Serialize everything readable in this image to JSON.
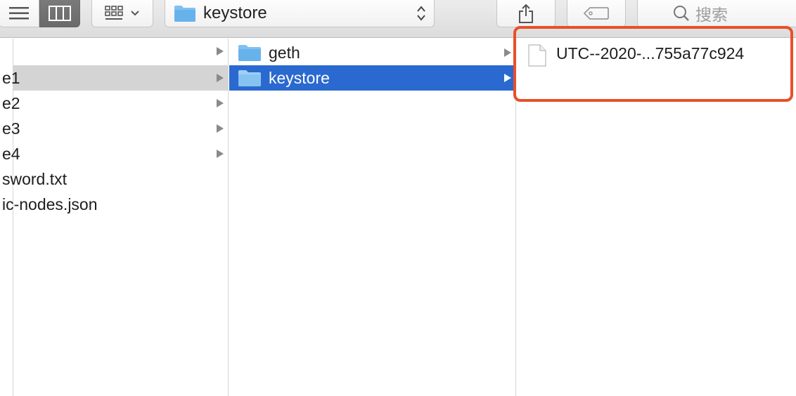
{
  "toolbar": {
    "view_list_icon": "list-view-icon",
    "view_column_icon": "column-view-icon",
    "group_icon": "grid-group-icon",
    "path_label": "keystore",
    "share_icon": "share-icon",
    "tag_icon": "tag-icon",
    "search_placeholder": "搜索"
  },
  "columns": {
    "col1": [
      {
        "label": "e1",
        "has_children": true,
        "selected": true
      },
      {
        "label": "e2",
        "has_children": true
      },
      {
        "label": "e3",
        "has_children": true
      },
      {
        "label": "e4",
        "has_children": true
      },
      {
        "label": "sword.txt",
        "has_children": false
      },
      {
        "label": "ic-nodes.json",
        "has_children": false
      }
    ],
    "col2": [
      {
        "label": "geth",
        "has_children": true
      },
      {
        "label": "keystore",
        "has_children": true,
        "selected": true
      }
    ],
    "col3": [
      {
        "label": "UTC--2020-...755a77c924"
      }
    ]
  },
  "colors": {
    "selection_blue": "#2a69cf",
    "selection_gray": "#d4d4d4",
    "highlight_red": "#e8502a"
  }
}
